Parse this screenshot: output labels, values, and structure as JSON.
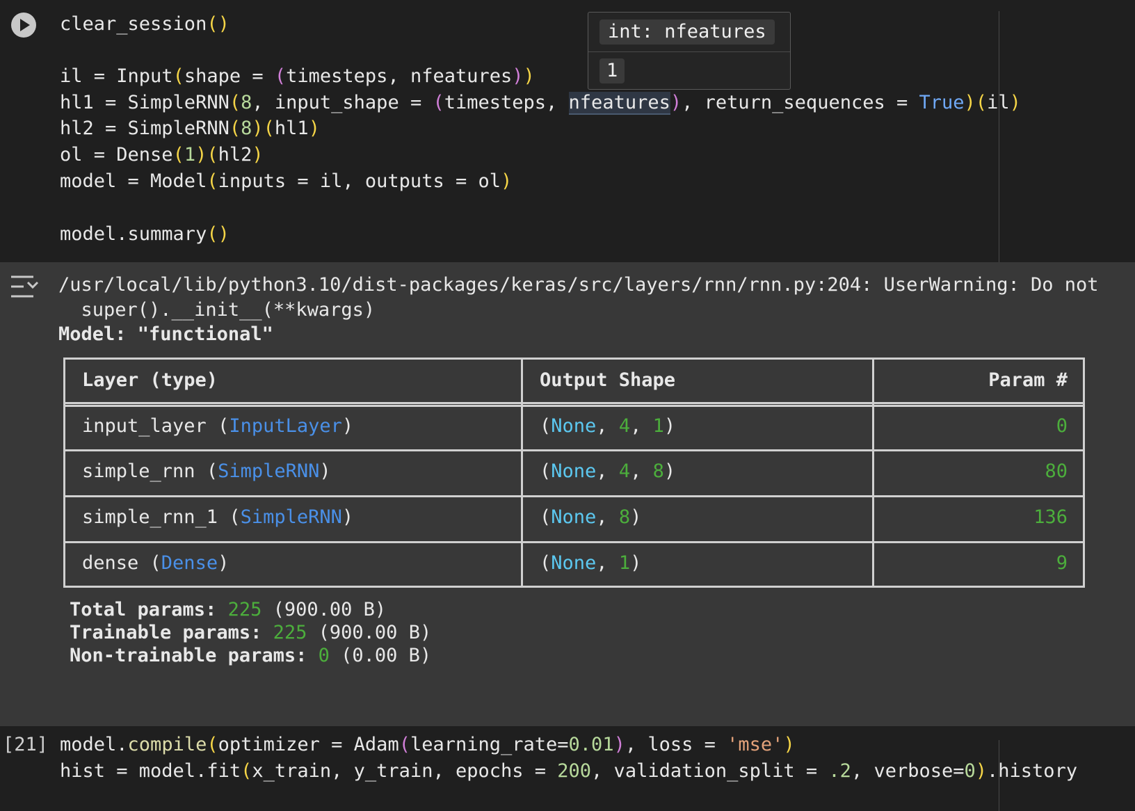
{
  "cell1": {
    "run_label": "Run cell",
    "code": {
      "l1_fn": "clear_session",
      "l1_open": "(",
      "l1_close": ")",
      "l3_a": "il = Input",
      "l3_b": "shape = ",
      "l3_c": "timesteps, nfeatures",
      "l4_a": "hl1 = SimpleRNN",
      "l4_b": "8",
      "l4_c": ", input_shape = ",
      "l4_d": "timesteps, ",
      "l4_e": "nfeatures",
      "l4_f": ", return_sequences = ",
      "l4_g": "True",
      "l4_h": "il",
      "l5_a": "hl2 = SimpleRNN",
      "l5_b": "8",
      "l5_c": "hl1",
      "l6_a": "ol = Dense",
      "l6_b": "1",
      "l6_c": "hl2",
      "l7_a": "model = Model",
      "l7_b": "inputs = il, outputs = ol",
      "l9_a": "model.summary"
    },
    "tooltip": {
      "signature": "int: nfeatures",
      "value": "1"
    }
  },
  "output": {
    "warning": "/usr/local/lib/python3.10/dist-packages/keras/src/layers/rnn/rnn.py:204: UserWarning: Do not",
    "warning_cont": "  super().__init__(**kwargs)",
    "model_title": "Model: \"functional\"",
    "table": {
      "headers": [
        "Layer (type)",
        "Output Shape",
        "Param #"
      ],
      "rows": [
        {
          "name": "input_layer",
          "type": "InputLayer",
          "shape_none": "None",
          "shape_rest": [
            "4",
            "1"
          ],
          "params": "0"
        },
        {
          "name": "simple_rnn",
          "type": "SimpleRNN",
          "shape_none": "None",
          "shape_rest": [
            "4",
            "8"
          ],
          "params": "80"
        },
        {
          "name": "simple_rnn_1",
          "type": "SimpleRNN",
          "shape_none": "None",
          "shape_rest": [
            "8"
          ],
          "params": "136"
        },
        {
          "name": "dense",
          "type": "Dense",
          "shape_none": "None",
          "shape_rest": [
            "1"
          ],
          "params": "9"
        }
      ]
    },
    "totals": [
      {
        "label": "Total params: ",
        "value": "225",
        "size": " (900.00 B)"
      },
      {
        "label": "Trainable params: ",
        "value": "225",
        "size": " (900.00 B)"
      },
      {
        "label": "Non-trainable params: ",
        "value": "0",
        "size": " (0.00 B)"
      }
    ]
  },
  "cell2": {
    "exec_count": "[21]",
    "l1_a": "model.",
    "l1_b": "compile",
    "l1_c": "optimizer = Adam",
    "l1_d": "learning_rate=",
    "l1_e": "0.01",
    "l1_f": ", loss = ",
    "l1_g": "'mse'",
    "l2_a": "hist = model.fit",
    "l2_b": "x_train, y_train, epochs = ",
    "l2_c": "200",
    "l2_d": ", validation_split = ",
    "l2_e": ".2",
    "l2_f": ", verbose=",
    "l2_g": "0",
    "l2_h": ".history"
  }
}
